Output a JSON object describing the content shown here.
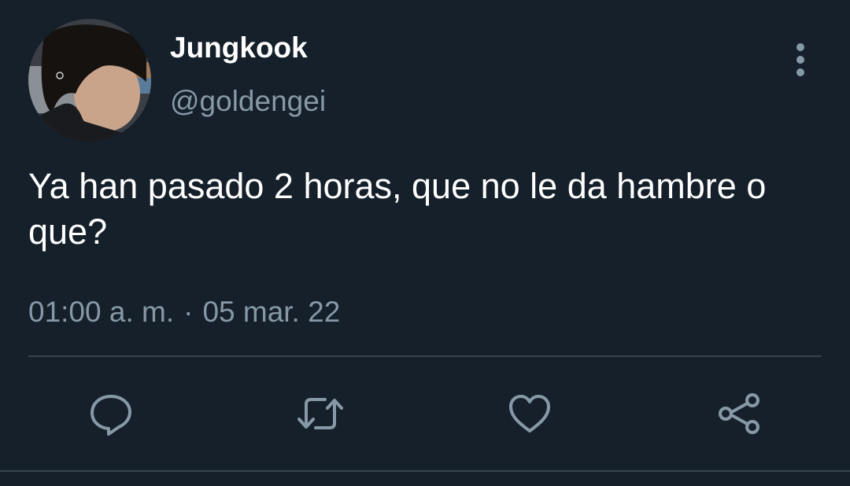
{
  "tweet": {
    "display_name": "Jungkook",
    "handle": "@goldengei",
    "text": "Ya han pasado 2 horas, que no le da hambre o que?",
    "time": "01:00 a. m.",
    "separator": "·",
    "date": "05 mar. 22"
  },
  "icons": {
    "avatar": "profile-photo",
    "more": "vertical-dots-icon",
    "reply": "speech-bubble-icon",
    "retweet": "retweet-arrows-icon",
    "like": "heart-icon",
    "share": "share-nodes-icon"
  },
  "colors": {
    "background": "#15202b",
    "primary_text": "#ffffff",
    "secondary_text": "#8899a6",
    "divider": "#38444d"
  }
}
